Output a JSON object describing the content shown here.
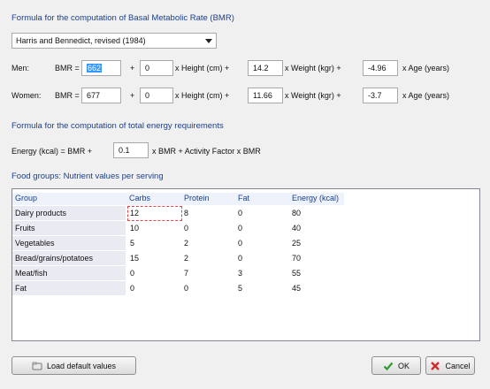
{
  "bmr_section": {
    "title": "Formula for the computation of Basal Metabolic Rate (BMR)",
    "formula_selected": "Harris and Bennedict, revised (1984)"
  },
  "men": {
    "label": "Men:",
    "bmr_eq": "BMR =",
    "base": "662",
    "plus": "+",
    "height_coef": "0",
    "height_txt": "x Height (cm) +",
    "weight_coef": "14.2",
    "weight_txt": "x Weight (kgr) +",
    "age_coef": "-4.96",
    "age_txt": "x Age (years)"
  },
  "women": {
    "label": "Women:",
    "bmr_eq": "BMR =",
    "base": "677",
    "plus": "+",
    "height_coef": "0",
    "height_txt": "x Height (cm) +",
    "weight_coef": "11.66",
    "weight_txt": "x Weight (kgr) +",
    "age_coef": "-3.7",
    "age_txt": "x Age (years)"
  },
  "energy_section": {
    "title": "Formula for the computation of total energy requirements",
    "lead": "Energy (kcal) = BMR +",
    "factor": "0.1",
    "tail": "x BMR + Activity Factor x BMR"
  },
  "food": {
    "title": "Food groups: Nutrient values per serving",
    "columns": [
      "Group",
      "Carbs",
      "Protein",
      "Fat",
      "Energy (kcal)"
    ],
    "rows": [
      [
        "Dairy products",
        "12",
        "8",
        "0",
        "80"
      ],
      [
        "Fruits",
        "10",
        "0",
        "0",
        "40"
      ],
      [
        "Vegetables",
        "5",
        "2",
        "0",
        "25"
      ],
      [
        "Bread/grains/potatoes",
        "15",
        "2",
        "0",
        "70"
      ],
      [
        "Meat/fish",
        "0",
        "7",
        "3",
        "55"
      ],
      [
        "Fat",
        "0",
        "0",
        "5",
        "45"
      ]
    ]
  },
  "buttons": {
    "load_default": "Load default values",
    "ok": "OK",
    "cancel": "Cancel"
  },
  "colors": {
    "header_text": "#1b3f8c",
    "selection": "#3399ff",
    "ok_check": "#2e9b2e",
    "cancel_x": "#d22b2b"
  }
}
